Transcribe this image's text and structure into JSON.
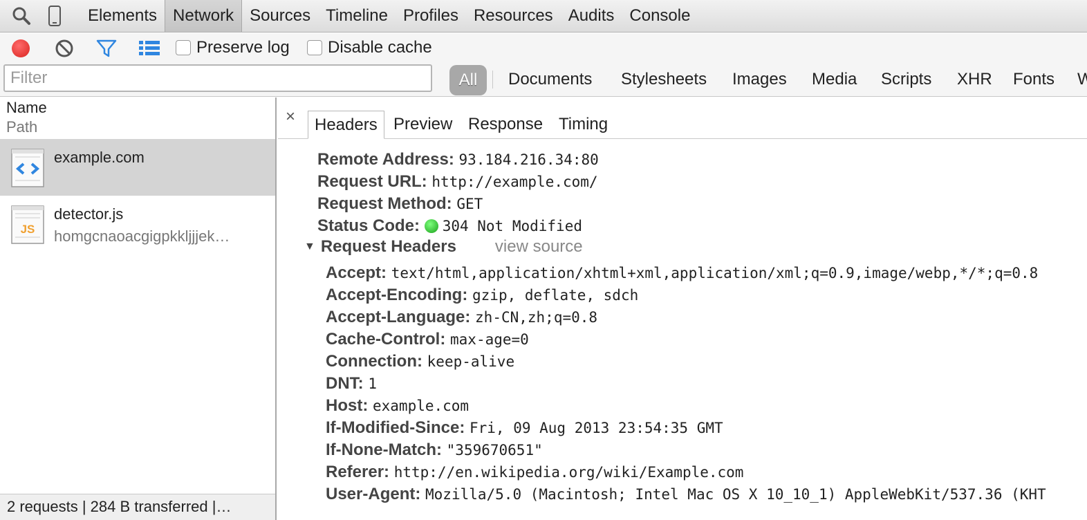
{
  "topbar": {
    "tabs": [
      "Elements",
      "Network",
      "Sources",
      "Timeline",
      "Profiles",
      "Resources",
      "Audits",
      "Console"
    ]
  },
  "toolbar": {
    "preserve_log": "Preserve log",
    "disable_cache": "Disable cache"
  },
  "filter": {
    "placeholder": "Filter",
    "all": "All",
    "types": [
      "Documents",
      "Stylesheets",
      "Images",
      "Media",
      "Scripts",
      "XHR",
      "Fonts",
      "W"
    ]
  },
  "list": {
    "col_name": "Name",
    "col_path": "Path",
    "requests": [
      {
        "name": "example.com",
        "path": ""
      },
      {
        "name": "detector.js",
        "path": "homgcnaoacgigpkkljjjek…"
      }
    ],
    "status": "2 requests | 284 B transferred |…"
  },
  "detail": {
    "close": "×",
    "tabs": [
      "Headers",
      "Preview",
      "Response",
      "Timing"
    ],
    "general": [
      {
        "key": "Remote Address:",
        "value": "93.184.216.34:80"
      },
      {
        "key": "Request URL:",
        "value": "http://example.com/"
      },
      {
        "key": "Request Method:",
        "value": "GET"
      },
      {
        "key": "Status Code:",
        "value": "304 Not Modified"
      }
    ],
    "request_headers_title": "Request Headers",
    "view_source": "view source",
    "request_headers": [
      {
        "key": "Accept:",
        "value": "text/html,application/xhtml+xml,application/xml;q=0.9,image/webp,*/*;q=0.8"
      },
      {
        "key": "Accept-Encoding:",
        "value": "gzip, deflate, sdch"
      },
      {
        "key": "Accept-Language:",
        "value": "zh-CN,zh;q=0.8"
      },
      {
        "key": "Cache-Control:",
        "value": "max-age=0"
      },
      {
        "key": "Connection:",
        "value": "keep-alive"
      },
      {
        "key": "DNT:",
        "value": "1"
      },
      {
        "key": "Host:",
        "value": "example.com"
      },
      {
        "key": "If-Modified-Since:",
        "value": "Fri, 09 Aug 2013 23:54:35 GMT"
      },
      {
        "key": "If-None-Match:",
        "value": "\"359670651\""
      },
      {
        "key": "Referer:",
        "value": "http://en.wikipedia.org/wiki/Example.com"
      },
      {
        "key": "User-Agent:",
        "value": "Mozilla/5.0 (Macintosh; Intel Mac OS X 10_10_1) AppleWebKit/537.36 (KHT"
      }
    ]
  },
  "colors": {
    "record": "#d9231f",
    "filter_icon": "#2f86e0",
    "status_ok": "#1aa01a"
  },
  "icons": [
    "search-icon",
    "device-mode-icon",
    "record-icon",
    "clear-icon",
    "filter-icon",
    "list-view-icon",
    "html-file-icon",
    "js-file-icon",
    "close-icon",
    "disclosure-triangle-icon"
  ]
}
